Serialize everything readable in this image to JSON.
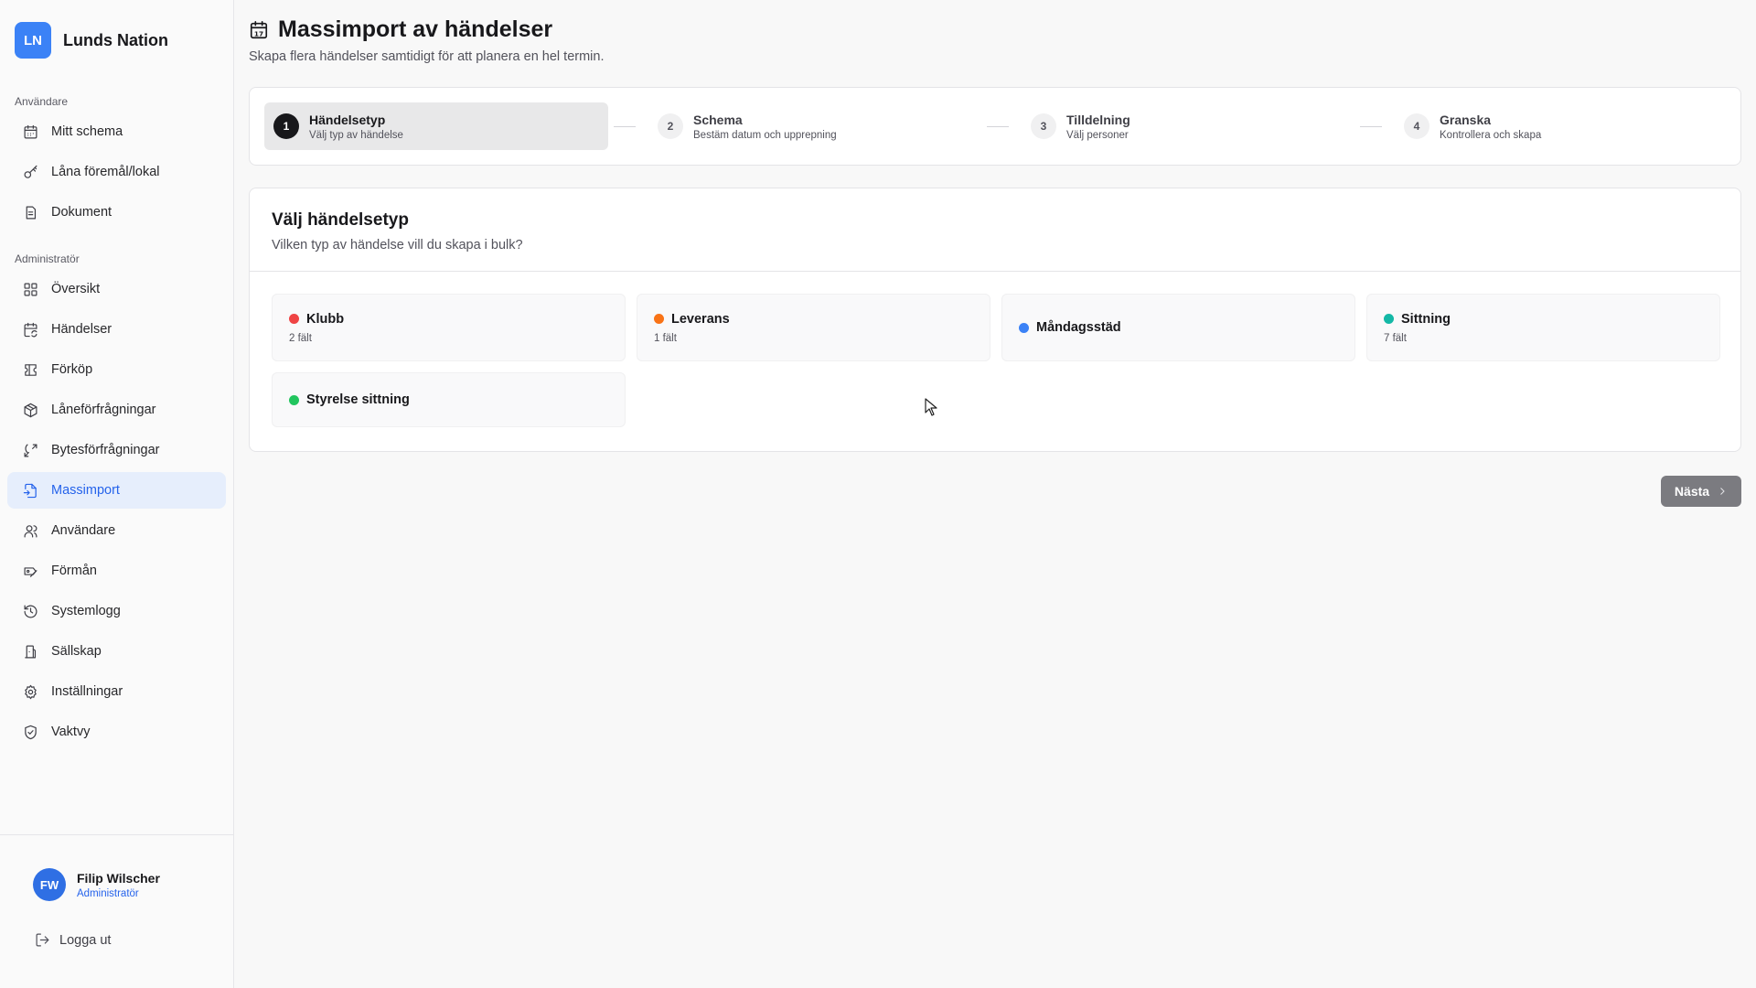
{
  "brand": {
    "initials": "LN",
    "name": "Lunds Nation",
    "color": "#3b82f6"
  },
  "sidebar": {
    "user_section_label": "Användare",
    "user_items": [
      {
        "label": "Mitt schema",
        "icon": "calendar-icon"
      },
      {
        "label": "Låna föremål/lokal",
        "icon": "key-icon"
      },
      {
        "label": "Dokument",
        "icon": "document-icon"
      }
    ],
    "admin_section_label": "Administratör",
    "admin_items": [
      {
        "label": "Översikt",
        "icon": "grid-icon"
      },
      {
        "label": "Händelser",
        "icon": "calendar-sync-icon"
      },
      {
        "label": "Förköp",
        "icon": "ticket-icon"
      },
      {
        "label": "Låneförfrågningar",
        "icon": "package-icon"
      },
      {
        "label": "Bytesförfrågningar",
        "icon": "swap-icon"
      },
      {
        "label": "Massimport",
        "icon": "file-import-icon",
        "active": true
      },
      {
        "label": "Användare",
        "icon": "users-icon"
      },
      {
        "label": "Förmån",
        "icon": "perk-icon"
      },
      {
        "label": "Systemlogg",
        "icon": "history-icon"
      },
      {
        "label": "Sällskap",
        "icon": "society-icon"
      },
      {
        "label": "Inställningar",
        "icon": "gear-icon"
      },
      {
        "label": "Vaktvy",
        "icon": "shield-check-icon"
      }
    ]
  },
  "user": {
    "initials": "FW",
    "name": "Filip Wilscher",
    "role": "Administratör"
  },
  "logout_label": "Logga ut",
  "header": {
    "title": "Massimport av händelser",
    "subtitle": "Skapa flera händelser samtidigt för att planera en hel termin.",
    "icon": "calendar-17-icon"
  },
  "steps": [
    {
      "num": "1",
      "title": "Händelsetyp",
      "desc": "Välj typ av händelse",
      "active": true
    },
    {
      "num": "2",
      "title": "Schema",
      "desc": "Bestäm datum och upprepning"
    },
    {
      "num": "3",
      "title": "Tilldelning",
      "desc": "Välj personer"
    },
    {
      "num": "4",
      "title": "Granska",
      "desc": "Kontrollera och skapa"
    }
  ],
  "card": {
    "title": "Välj händelsetyp",
    "subtitle": "Vilken typ av händelse vill du skapa i bulk?"
  },
  "event_types": [
    {
      "name": "Klubb",
      "meta": "2 fält",
      "color": "#ef4444"
    },
    {
      "name": "Leverans",
      "meta": "1 fält",
      "color": "#f97316"
    },
    {
      "name": "Måndagsstäd",
      "meta": "",
      "color": "#3b82f6"
    },
    {
      "name": "Sittning",
      "meta": "7 fält",
      "color": "#14b8a6"
    },
    {
      "name": "Styrelse sittning",
      "meta": "",
      "color": "#22c55e"
    }
  ],
  "next_label": "Nästa"
}
